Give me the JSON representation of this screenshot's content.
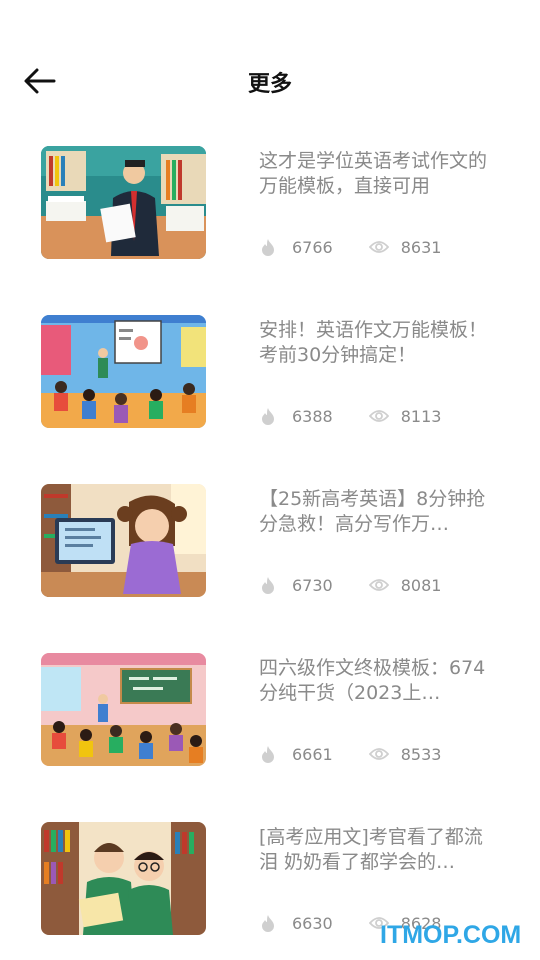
{
  "header": {
    "title": "更多",
    "back_icon": "arrow-left-icon"
  },
  "items": [
    {
      "title": "这才是学位英语考试作文的万能模板，直接可用",
      "likes": "6766",
      "views": "8631",
      "thumb": "teacher-reading-office"
    },
    {
      "title": "安排！英语作文万能模板！考前30分钟搞定！",
      "likes": "6388",
      "views": "8113",
      "thumb": "classroom-lecture"
    },
    {
      "title": "【25新高考英语】8分钟抢分急救！高分写作万…",
      "likes": "6730",
      "views": "8081",
      "thumb": "girl-at-computer"
    },
    {
      "title": "四六级作文终极模板：674分纯干货（2023上…",
      "likes": "6661",
      "views": "8533",
      "thumb": "busy-classroom"
    },
    {
      "title": "[高考应用文]考官看了都流泪 奶奶看了都学会的…",
      "likes": "6630",
      "views": "8628",
      "thumb": "two-boys-library"
    }
  ],
  "icons": {
    "likes": "flame-icon",
    "views": "eye-icon"
  },
  "watermark": "ITMOP.COM",
  "colors": {
    "meta_text": "#8a8a8a",
    "title": "#111111",
    "watermark": "#2fa7e6"
  }
}
